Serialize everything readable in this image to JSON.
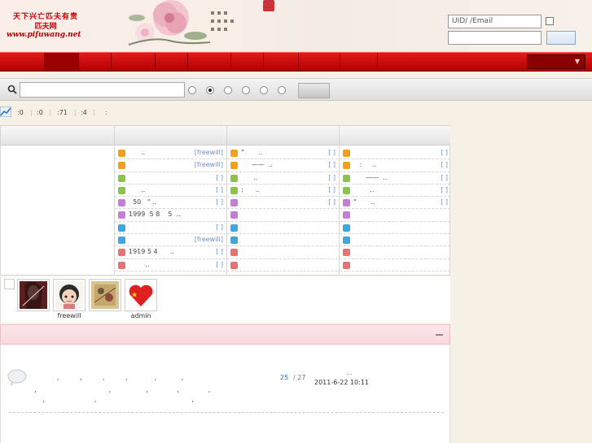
{
  "header": {
    "logo_line1": "天下兴亡匹夫有责",
    "logo_line2": "匹夫网",
    "logo_url": "www.pifuwang.net"
  },
  "login": {
    "username_value": "UID/  /Email"
  },
  "colors": {
    "nav_red": "#c80000",
    "link_blue": "#6b8fc7",
    "panel_pink": "#fbe0e5"
  },
  "search": {
    "radio_selected_index": 1
  },
  "stats": [
    ":0",
    ":0",
    ":71",
    ":4",
    ":"
  ],
  "forum": {
    "columns": [
      {
        "rows": [
          {
            "text": "      ..",
            "tag": "[freewill]",
            "color": "#f0a020"
          },
          {
            "text": "",
            "tag": "[freewill]",
            "color": "#f0a020"
          },
          {
            "text": "",
            "tag": "[ ]",
            "color": "#8bc34a"
          },
          {
            "text": "      ..",
            "tag": "[  ]",
            "color": "#8bc34a"
          },
          {
            "text": "  50   \" ..",
            "tag": "[ ]",
            "color": "#c77dd8"
          },
          {
            "text": "1999  5 8    5  ..",
            "tag": "",
            "color": "#c77dd8"
          },
          {
            "text": "",
            "tag": "[ ]",
            "color": "#3fa7e0"
          },
          {
            "text": "",
            "tag": "[freewill]",
            "color": "#3fa7e0"
          },
          {
            "text": "1919 5 4      ..",
            "tag": "[ ]",
            "color": "#e57373"
          },
          {
            "text": "        ..",
            "tag": "[ ]",
            "color": "#e57373"
          }
        ]
      },
      {
        "rows": [
          {
            "text": "\"       ..",
            "tag": "[ ]",
            "color": "#f0a020"
          },
          {
            "text": "     ——  ..",
            "tag": "[ ]",
            "color": "#f0a020"
          },
          {
            "text": "      ..",
            "tag": "[ ]",
            "color": "#8bc34a"
          },
          {
            "text": ":      ..",
            "tag": "[ ]",
            "color": "#8bc34a"
          },
          {
            "text": "",
            "tag": "[ ]",
            "color": "#c77dd8"
          },
          {
            "text": "",
            "tag": "",
            "color": "#c77dd8"
          },
          {
            "text": "",
            "tag": "",
            "color": "#3fa7e0"
          },
          {
            "text": "",
            "tag": "",
            "color": "#3fa7e0"
          },
          {
            "text": "",
            "tag": "",
            "color": "#e57373"
          },
          {
            "text": "",
            "tag": "",
            "color": "#e57373"
          }
        ]
      },
      {
        "rows": [
          {
            "text": "",
            "tag": "[ ]",
            "color": "#f0a020"
          },
          {
            "text": "   :     ..",
            "tag": "[ ]",
            "color": "#f0a020"
          },
          {
            "text": "      ——  ..",
            "tag": "[ ]",
            "color": "#8bc34a"
          },
          {
            "text": "        ..",
            "tag": "[ ]",
            "color": "#8bc34a"
          },
          {
            "text": "\"       ..",
            "tag": "[ ]",
            "color": "#c77dd8"
          },
          {
            "text": "",
            "tag": "",
            "color": "#c77dd8"
          },
          {
            "text": "",
            "tag": "",
            "color": "#3fa7e0"
          },
          {
            "text": "",
            "tag": "",
            "color": "#3fa7e0"
          },
          {
            "text": "",
            "tag": "",
            "color": "#e57373"
          },
          {
            "text": "",
            "tag": "",
            "color": "#e57373"
          }
        ]
      }
    ]
  },
  "avatars": [
    {
      "name": "",
      "icon": "portrait-avatar"
    },
    {
      "name": "freewill",
      "icon": "cartoon-girl-avatar"
    },
    {
      "name": "",
      "icon": "painting-avatar"
    },
    {
      "name": "admin",
      "icon": "heart-flag-avatar"
    }
  ],
  "post": {
    "line1": "             ,          ,          ,          ,             ,            ,",
    "line2": "  ,                                   ,                 ,              ,              ,",
    "line3": "      ,                        ,                                              ,",
    "replies": "25",
    "views": "/ 27",
    "ellipsis": "...",
    "date": "2011-6-22 10:11"
  }
}
